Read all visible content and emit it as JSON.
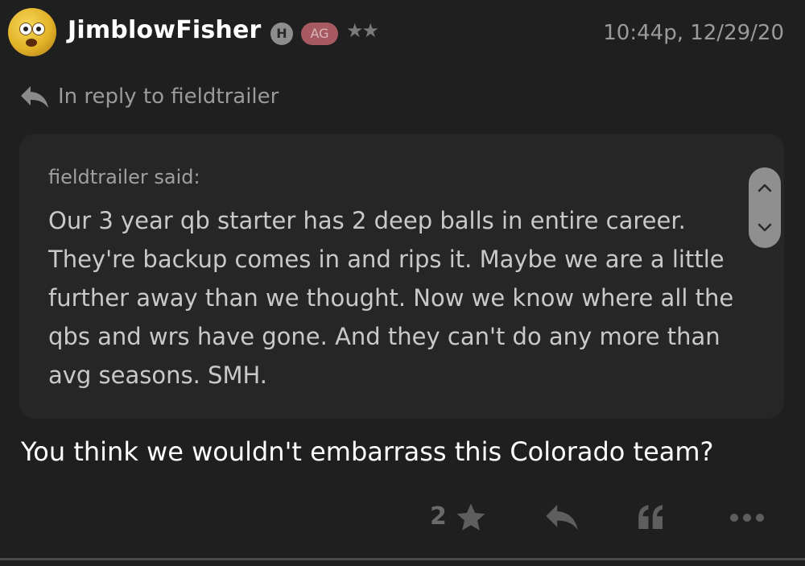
{
  "post": {
    "username": "JimblowFisher",
    "badges": {
      "h": "H",
      "ag": "AG"
    },
    "rank_stars": "★★",
    "timestamp": "10:44p, 12/29/20",
    "reply_to": "In reply to fieldtrailer",
    "quote": {
      "author": "fieldtrailer said:",
      "text": "Our 3 year qb starter has 2 deep balls in entire career. They're backup comes in and rips it. Maybe we are a little further away than we thought. Now we know where all the qbs and wrs have gone. And they can't do any more than avg seasons. SMH."
    },
    "body": "You think we wouldn't embarrass this Colorado team?",
    "actions": {
      "like_count": "2"
    }
  },
  "icons": {
    "avatar": "surprised-face-avatar",
    "reply": "reply-arrow-icon",
    "like": "star-icon",
    "quote": "quote-icon",
    "more": "more-dots-icon",
    "expand": "chevron-up-icon",
    "collapse": "chevron-down-icon"
  },
  "colors": {
    "background": "#1f1f1f",
    "quote_background": "#262626",
    "ag_badge": "#a85a62",
    "muted_text": "#9a9a9a"
  }
}
